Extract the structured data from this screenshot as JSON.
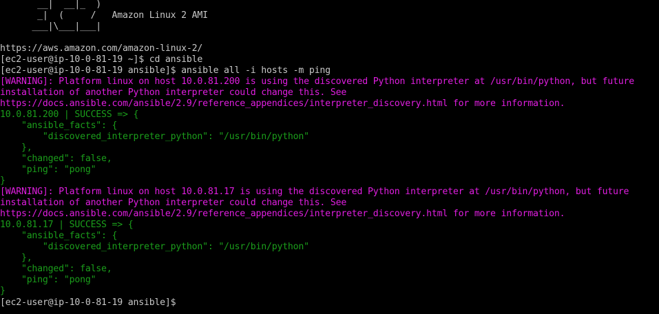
{
  "theme": {
    "background": "#000000",
    "default_fg": "#c8c8c8",
    "warning_fg": "#e01ee0",
    "success_fg": "#1b9e1b"
  },
  "terminal": {
    "lines": [
      {
        "text": "       __|  __|_  )",
        "kind": "default"
      },
      {
        "text": "       _|  (     /   Amazon Linux 2 AMI",
        "kind": "default"
      },
      {
        "text": "      ___|\\___|___|",
        "kind": "default"
      },
      {
        "text": "",
        "kind": "default"
      },
      {
        "text": "https://aws.amazon.com/amazon-linux-2/",
        "kind": "default"
      },
      {
        "text": "[ec2-user@ip-10-0-81-19 ~]$ cd ansible",
        "kind": "prompt"
      },
      {
        "text": "[ec2-user@ip-10-0-81-19 ansible]$ ansible all -i hosts -m ping",
        "kind": "prompt"
      },
      {
        "text": "[WARNING]: Platform linux on host 10.0.81.200 is using the discovered Python interpreter at /usr/bin/python, but future",
        "kind": "warning"
      },
      {
        "text": "installation of another Python interpreter could change this. See",
        "kind": "warning"
      },
      {
        "text": "https://docs.ansible.com/ansible/2.9/reference_appendices/interpreter_discovery.html for more information.",
        "kind": "warning"
      },
      {
        "text": "10.0.81.200 | SUCCESS => {",
        "kind": "success"
      },
      {
        "text": "    \"ansible_facts\": {",
        "kind": "success"
      },
      {
        "text": "        \"discovered_interpreter_python\": \"/usr/bin/python\"",
        "kind": "success"
      },
      {
        "text": "    },",
        "kind": "success"
      },
      {
        "text": "    \"changed\": false,",
        "kind": "success"
      },
      {
        "text": "    \"ping\": \"pong\"",
        "kind": "success"
      },
      {
        "text": "}",
        "kind": "success"
      },
      {
        "text": "[WARNING]: Platform linux on host 10.0.81.17 is using the discovered Python interpreter at /usr/bin/python, but future",
        "kind": "warning"
      },
      {
        "text": "installation of another Python interpreter could change this. See",
        "kind": "warning"
      },
      {
        "text": "https://docs.ansible.com/ansible/2.9/reference_appendices/interpreter_discovery.html for more information.",
        "kind": "warning"
      },
      {
        "text": "10.0.81.17 | SUCCESS => {",
        "kind": "success"
      },
      {
        "text": "    \"ansible_facts\": {",
        "kind": "success"
      },
      {
        "text": "        \"discovered_interpreter_python\": \"/usr/bin/python\"",
        "kind": "success"
      },
      {
        "text": "    },",
        "kind": "success"
      },
      {
        "text": "    \"changed\": false,",
        "kind": "success"
      },
      {
        "text": "    \"ping\": \"pong\"",
        "kind": "success"
      },
      {
        "text": "}",
        "kind": "success"
      },
      {
        "text": "[ec2-user@ip-10-0-81-19 ansible]$ ",
        "kind": "prompt"
      }
    ]
  }
}
